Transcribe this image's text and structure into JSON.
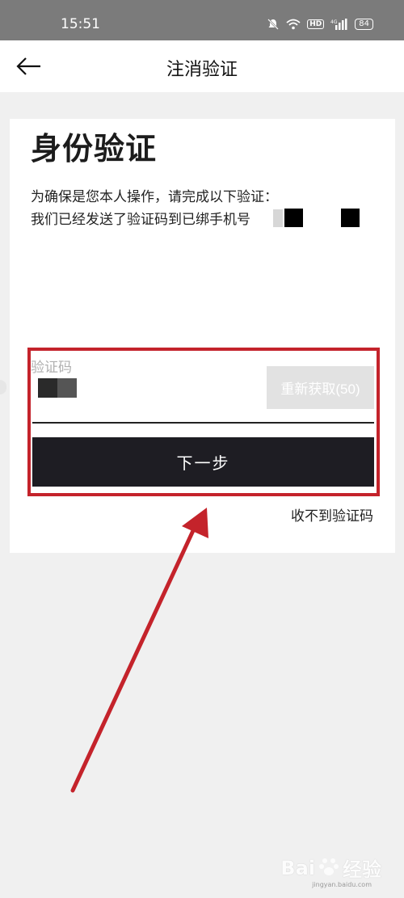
{
  "status_bar": {
    "time": "15:51",
    "icons": [
      "mute-bell-icon",
      "wifi-icon",
      "hd-icon",
      "signal-icon",
      "battery-icon"
    ],
    "hd": "HD",
    "network": "4G",
    "battery": "84"
  },
  "header": {
    "title": "注消验证",
    "back_icon": "back-arrow-icon"
  },
  "main": {
    "title": "身份验证",
    "desc_line1": "为确保是您本人操作，请完成以下验证：",
    "desc_line2": "我们已经发送了验证码到已绑手机号",
    "code_label": "验证码",
    "resend_label": "重新获取(50)",
    "next_label": "下一步",
    "no_code_link": "收不到验证码"
  },
  "annotation": {
    "color": "#c4232b"
  },
  "watermark": {
    "brand": "Bai",
    "brand_cn": "经验",
    "sub": "jingyan.baidu.com"
  }
}
